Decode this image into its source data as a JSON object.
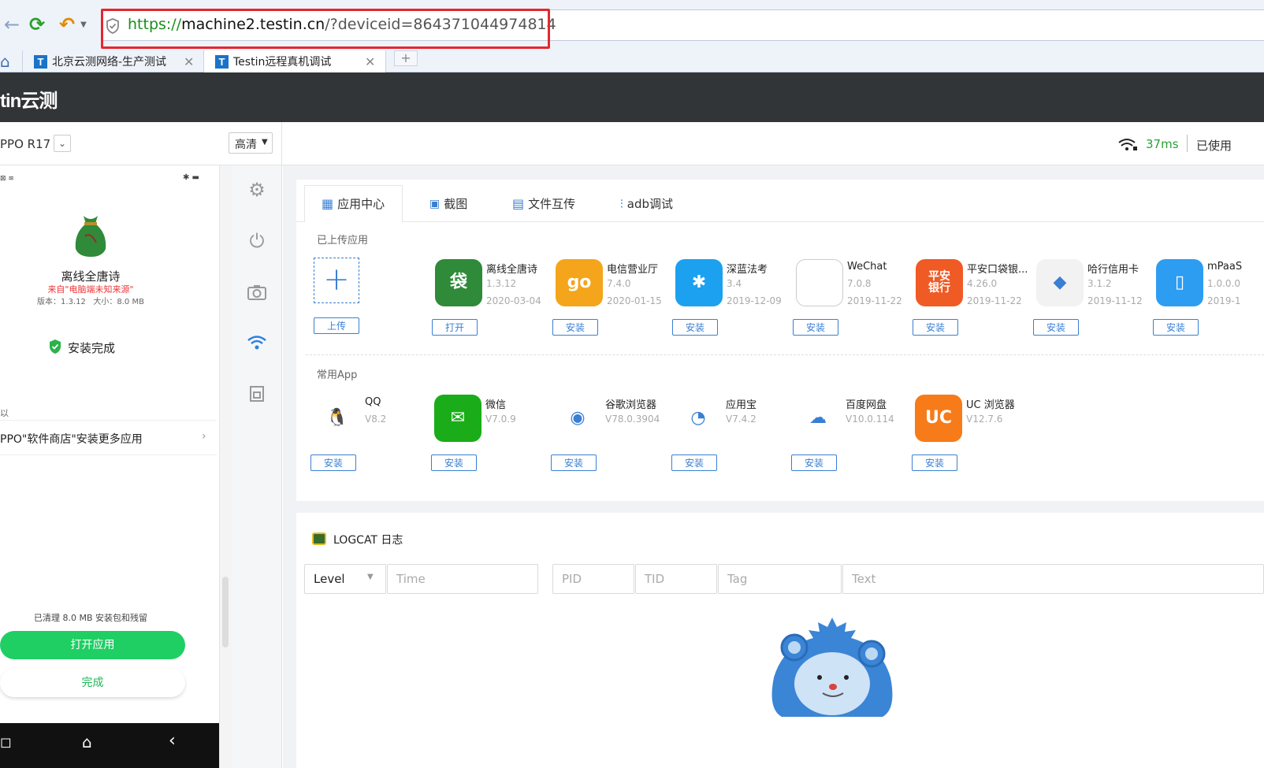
{
  "browser": {
    "url_proto": "https://",
    "url_host": "machine2.testin.cn",
    "url_path": "/?deviceid=864371044974814",
    "tabs": [
      {
        "label": "北京云测网络-生产测试"
      },
      {
        "label": "Testin远程真机调试"
      }
    ],
    "new_tab": "+"
  },
  "app": {
    "brand": "tin云测"
  },
  "topbar": {
    "device_name": "PPO R17",
    "quality": "高清",
    "latency": "37ms",
    "used_label": "已使用"
  },
  "device": {
    "app_title": "离线全唐诗",
    "source_note": "来自\"电脑端未知来源\"",
    "version_size": "版本：1.3.12   大小：8.0 MB",
    "install_status": "安装完成",
    "fragment": "以",
    "store_prompt": "PPO\"软件商店\"安装更多应用",
    "cleanup_note": "已清理 8.0 MB 安装包和残留",
    "open_btn": "打开应用",
    "done_btn": "完成"
  },
  "tabs": [
    {
      "label": "应用中心",
      "icon": "apps-icon"
    },
    {
      "label": "截图",
      "icon": "image-icon"
    },
    {
      "label": "文件互传",
      "icon": "file-icon"
    },
    {
      "label": "adb调试",
      "icon": "sliders-icon"
    }
  ],
  "uploaded": {
    "title": "已上传应用",
    "upload_label": "上传",
    "apps": [
      {
        "name": "离线全唐诗",
        "version": "1.3.12",
        "date": "2020-03-04",
        "action": "打开",
        "color": "#2f8a3a"
      },
      {
        "name": "电信营业厅",
        "version": "7.4.0",
        "date": "2020-01-15",
        "action": "安装",
        "color": "#f4a51c"
      },
      {
        "name": "深蓝法考",
        "version": "3.4",
        "date": "2019-12-09",
        "action": "安装",
        "color": "#1ba1f0"
      },
      {
        "name": "WeChat",
        "version": "7.0.8",
        "date": "2019-11-22",
        "action": "安装",
        "color": "#ffffff"
      },
      {
        "name": "平安口袋银...",
        "version": "4.26.0",
        "date": "2019-11-22",
        "action": "安装",
        "color": "#f05a24"
      },
      {
        "name": "哈行信用卡",
        "version": "3.1.2",
        "date": "2019-11-12",
        "action": "安装",
        "color": "#f2f2f2"
      },
      {
        "name": "mPaaS",
        "version": "1.0.0.0",
        "date": "2019-1",
        "action": "安装",
        "color": "#2d9df2"
      }
    ]
  },
  "common": {
    "title": "常用App",
    "apps": [
      {
        "name": "QQ",
        "version": "V8.2",
        "action": "安装",
        "color": "#ffffff"
      },
      {
        "name": "微信",
        "version": "V7.0.9",
        "action": "安装",
        "color": "#1aad19"
      },
      {
        "name": "谷歌浏览器",
        "version": "V78.0.3904",
        "action": "安装",
        "color": "#ffffff"
      },
      {
        "name": "应用宝",
        "version": "V7.4.2",
        "action": "安装",
        "color": "#ffffff"
      },
      {
        "name": "百度网盘",
        "version": "V10.0.114",
        "action": "安装",
        "color": "#ffffff"
      },
      {
        "name": "UC 浏览器",
        "version": "V12.7.6",
        "action": "安装",
        "color": "#f77b18"
      }
    ]
  },
  "logcat": {
    "title": "LOGCAT 日志",
    "level": "Level",
    "time_ph": "Time",
    "pid_ph": "PID",
    "tid_ph": "TID",
    "tag_ph": "Tag",
    "text_ph": "Text"
  }
}
